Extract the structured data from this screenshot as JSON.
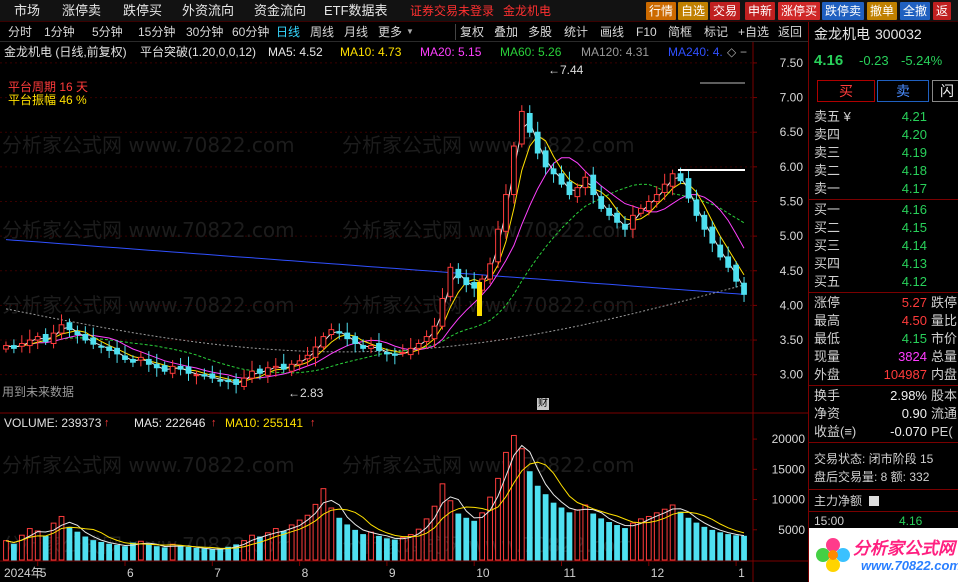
{
  "menu": {
    "left_items": [
      "市场",
      "涨停卖",
      "跌停买",
      "外资流向",
      "资金流向",
      "ETF数据表"
    ],
    "login_notice": "证券交易未登录",
    "stock_tag": "金龙机电",
    "right_buttons": [
      {
        "label": "行情",
        "color": "#cc6a00"
      },
      {
        "label": "自选",
        "color": "#c08000"
      },
      {
        "label": "交易",
        "color": "#c02020"
      },
      {
        "label": "申新",
        "color": "#c02020"
      },
      {
        "label": "涨停买",
        "color": "#d02828"
      },
      {
        "label": "跌停卖",
        "color": "#2060c0"
      },
      {
        "label": "撤单",
        "color": "#c08000"
      },
      {
        "label": "全撤",
        "color": "#2060c0"
      },
      {
        "label": "返",
        "color": "#c02020"
      }
    ]
  },
  "period_bar": {
    "items": [
      "分时",
      "1分钟",
      "5分钟",
      "15分钟",
      "30分钟",
      "60分钟",
      "日线",
      "周线",
      "月线",
      "更多"
    ],
    "active": "日线",
    "tools": [
      "复权",
      "叠加",
      "多股",
      "统计",
      "画线",
      "F10",
      "简框",
      "标记",
      "+自选",
      "返回"
    ]
  },
  "indicator_line": {
    "stock": "金龙机电 (日线,前复权)",
    "formula": "平台突破(1.20,0,0,12)",
    "ma5": "MA5: 4.52",
    "ma10": "MA10: 4.73",
    "ma20": "MA20: 5.15",
    "ma60": "MA60: 5.26",
    "ma120": "MA120: 4.31",
    "ma240": "MA240: 4."
  },
  "annotations": {
    "platform_period": "平台周期 16 天",
    "platform_amplitude": "平台振幅 46 %",
    "high_label": "7.44",
    "low_label": "2.83",
    "future_note": "用到未来数据",
    "event_tag": "财",
    "watermark": "分析家公式网 www.70822.com"
  },
  "volume_line": {
    "volume": "VOLUME: 239373",
    "ma5": "MA5: 222646",
    "ma10": "MA10: 255141"
  },
  "x_axis": {
    "year": "2024年",
    "months": [
      "5",
      "6",
      "7",
      "8",
      "9",
      "10",
      "11",
      "12",
      "1"
    ]
  },
  "price_axis": [
    "7.50",
    "7.00",
    "6.50",
    "6.00",
    "5.50",
    "5.00",
    "4.50",
    "4.00",
    "3.50",
    "3.00"
  ],
  "volume_axis": [
    "20000",
    "15000",
    "10000",
    "5000"
  ],
  "chart_data": {
    "type": "candlestick",
    "price_range": [
      2.75,
      7.6
    ],
    "close_series": [
      3.42,
      3.38,
      3.45,
      3.5,
      3.55,
      3.48,
      3.6,
      3.72,
      3.65,
      3.58,
      3.5,
      3.44,
      3.4,
      3.35,
      3.3,
      3.22,
      3.18,
      3.25,
      3.15,
      3.1,
      3.05,
      3.12,
      3.08,
      3.02,
      3.0,
      2.98,
      2.95,
      2.92,
      2.9,
      2.86,
      2.95,
      3.05,
      3.02,
      3.1,
      3.12,
      3.08,
      3.15,
      3.2,
      3.28,
      3.4,
      3.55,
      3.65,
      3.6,
      3.52,
      3.45,
      3.38,
      3.42,
      3.35,
      3.3,
      3.28,
      3.32,
      3.38,
      3.45,
      3.55,
      3.7,
      4.1,
      4.55,
      4.4,
      4.3,
      4.25,
      4.38,
      4.6,
      5.1,
      5.6,
      6.3,
      6.8,
      6.5,
      6.2,
      6.0,
      5.9,
      5.75,
      5.6,
      5.7,
      5.85,
      5.6,
      5.4,
      5.3,
      5.2,
      5.1,
      5.3,
      5.4,
      5.5,
      5.6,
      5.75,
      5.9,
      5.8,
      5.55,
      5.3,
      5.1,
      4.9,
      4.7,
      4.55,
      4.35,
      4.16
    ],
    "volume_series": [
      3200,
      2600,
      4100,
      5200,
      4800,
      3900,
      6100,
      7200,
      5400,
      4600,
      3800,
      3200,
      2900,
      2600,
      2400,
      2200,
      2800,
      3100,
      2500,
      2200,
      2000,
      2600,
      2300,
      2100,
      1900,
      1800,
      1700,
      1900,
      2100,
      2500,
      3200,
      4100,
      3800,
      4500,
      5200,
      4700,
      5800,
      6600,
      7400,
      9200,
      11800,
      8600,
      6900,
      5800,
      4900,
      4200,
      4600,
      3900,
      3500,
      3300,
      3700,
      4200,
      5100,
      6800,
      8900,
      12600,
      9800,
      7600,
      6900,
      6400,
      7800,
      10400,
      13500,
      17800,
      20600,
      18400,
      14600,
      12200,
      10800,
      9400,
      8600,
      7800,
      8300,
      9100,
      7600,
      6800,
      6200,
      5700,
      5200,
      6100,
      6800,
      7200,
      7800,
      8400,
      9100,
      7900,
      6900,
      6100,
      5400,
      4900,
      4500,
      4200,
      4000,
      3924
    ],
    "ma_names": [
      "MA5",
      "MA10",
      "MA20",
      "MA60",
      "MA120",
      "MA240"
    ],
    "colors": {
      "MA5": "#e8e8e8",
      "MA10": "#ffe000",
      "MA20": "#ff40ff",
      "MA60": "#2ad13a",
      "MA120": "#9a9a9a",
      "MA240": "#3050ff",
      "up": "#ff3c3c",
      "down": "#4fe0f0"
    }
  },
  "quote_panel": {
    "name": "金龙机电",
    "code": "300032",
    "price": "4.16",
    "change": "-0.23",
    "pct": "-5.24%",
    "buy_btn": "买",
    "sell_btn": "卖",
    "third_btn": "闪",
    "asks": [
      {
        "label": "卖五 ¥",
        "price": "4.21"
      },
      {
        "label": "卖四",
        "price": "4.20"
      },
      {
        "label": "卖三",
        "price": "4.19"
      },
      {
        "label": "卖二",
        "price": "4.18"
      },
      {
        "label": "卖一",
        "price": "4.17"
      }
    ],
    "bids": [
      {
        "label": "买一",
        "price": "4.16"
      },
      {
        "label": "买二",
        "price": "4.15"
      },
      {
        "label": "买三",
        "price": "4.14"
      },
      {
        "label": "买四",
        "price": "4.13"
      },
      {
        "label": "买五",
        "price": "4.12"
      }
    ],
    "stats": [
      {
        "label": "涨停",
        "value": "5.27",
        "extra": "跌停"
      },
      {
        "label": "最高",
        "value": "4.50",
        "extra": "量比"
      },
      {
        "label": "最低",
        "value": "4.15",
        "extra": "市价"
      },
      {
        "label": "现量",
        "value": "3824",
        "extra": "总量"
      },
      {
        "label": "外盘",
        "value": "104987",
        "extra": "内盘"
      }
    ],
    "turnover": {
      "label": "换手",
      "value": "2.98%",
      "extra": "股本"
    },
    "netasset": {
      "label": "净资",
      "value": "0.90",
      "extra": "流通"
    },
    "earnings": {
      "label": "收益(≡)",
      "value": "-0.070",
      "extra": "PE("
    },
    "status": "交易状态: 闭市阶段 15",
    "after_hours": "盘后交易量: 8  额: 332",
    "main_flow": "主力净额",
    "last_tick": {
      "time": "15:00",
      "price": "4.16"
    },
    "logo": "分析家公式网",
    "logo_url": "www.70822.com"
  }
}
